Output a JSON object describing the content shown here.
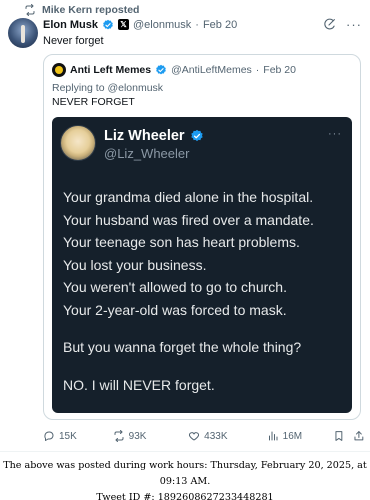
{
  "repost": {
    "text": "Mike Kern reposted"
  },
  "tweet": {
    "author_name": "Elon Musk",
    "handle": "@elonmusk",
    "separator": "·",
    "date": "Feb 20",
    "text": "Never forget"
  },
  "quote": {
    "author_name": "Anti Left Memes",
    "handle": "@AntiLeftMemes",
    "separator": "·",
    "date": "Feb 20",
    "replying_prefix": "Replying to",
    "replying_to": "@elonmusk",
    "text": "NEVER FORGET"
  },
  "image": {
    "name": "Liz Wheeler",
    "handle": "@Liz_Wheeler",
    "more": "···",
    "lines": [
      "Your grandma died alone in the hospital.",
      "Your husband was fired over a mandate.",
      "Your teenage son has heart problems.",
      "You lost your business.",
      "You weren't allowed to go to church.",
      "Your 2-year-old was forced to mask."
    ],
    "question": "But you wanna forget the whole thing?",
    "closing": "NO. I will NEVER forget."
  },
  "actions": {
    "replies": "15K",
    "reposts": "93K",
    "likes": "433K",
    "views": "16M"
  },
  "footer": {
    "line1": "The above was posted during work hours: Thursday, February 20, 2025, at 09:13 AM.",
    "line2": "Tweet ID #: 1892608627233448281"
  },
  "colors": {
    "verified": "#1d9bf0",
    "dark_card": "#15202b",
    "secondary_text": "#536471"
  }
}
